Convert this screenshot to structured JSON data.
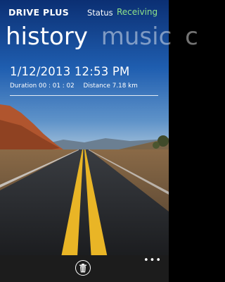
{
  "header": {
    "app_title": "DRIVE PLUS",
    "status_label": "Status",
    "status_value": "Receiving"
  },
  "pivot": {
    "tabs": [
      {
        "label": "history",
        "active": true
      },
      {
        "label": "music",
        "active": false
      },
      {
        "label": "c",
        "active": false
      }
    ]
  },
  "record": {
    "datetime": "1/12/2013 12:53 PM",
    "duration": "Duration 00 : 01 : 02",
    "distance": "Distance 7.18 km"
  },
  "app_bar": {
    "delete_icon": "trash-icon",
    "more_label": "•••"
  },
  "colors": {
    "accent": "#8fe38a",
    "app_bar": "#1c1c1c"
  }
}
